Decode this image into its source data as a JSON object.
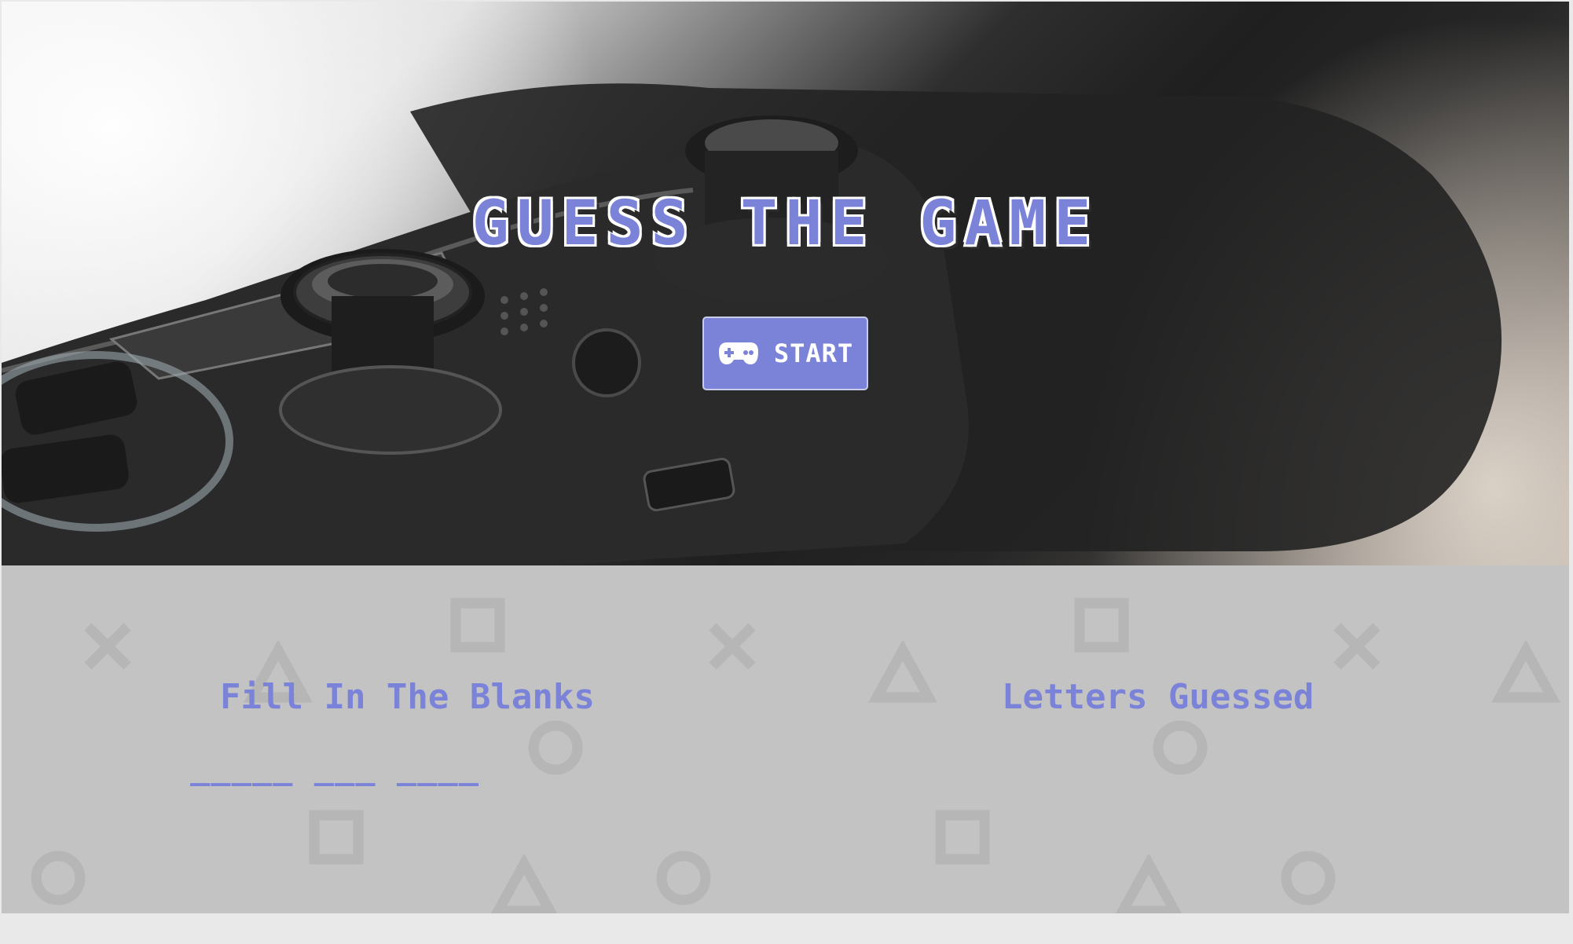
{
  "hero": {
    "title": "GUESS THE GAME",
    "background_image": "gamepad-controller-photo",
    "start_button": {
      "label": "START",
      "icon": "gamepad-icon",
      "color": "#7b83d9"
    }
  },
  "game": {
    "blanks_heading": "Fill In The Blanks",
    "word_blanks": "_____ ___ ____",
    "guessed_heading": "Letters Guessed",
    "letters_guessed": ""
  },
  "theme": {
    "accent": "#7b83d9",
    "panel_background": "#c3c3c3",
    "pattern_icons": [
      "cross-icon",
      "square-icon",
      "triangle-icon",
      "circle-icon"
    ]
  }
}
